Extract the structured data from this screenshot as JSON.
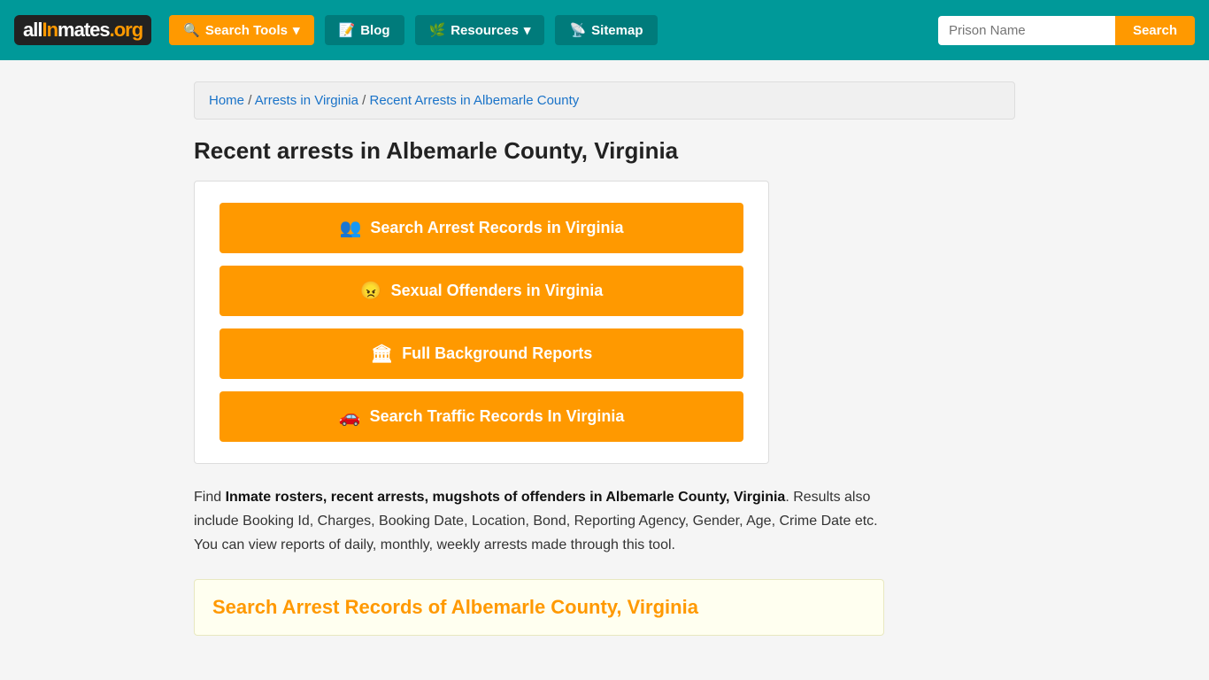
{
  "navbar": {
    "logo": {
      "all": "all",
      "in": "In",
      "mates": "mates",
      "org": ".org"
    },
    "nav_items": [
      {
        "id": "search-tools",
        "label": "Search Tools",
        "icon": "🔍",
        "has_dropdown": true
      },
      {
        "id": "blog",
        "label": "Blog",
        "icon": "📝",
        "has_dropdown": false
      },
      {
        "id": "resources",
        "label": "Resources",
        "icon": "🌿",
        "has_dropdown": true
      },
      {
        "id": "sitemap",
        "label": "Sitemap",
        "icon": "📡",
        "has_dropdown": false
      }
    ],
    "search_placeholder": "Prison Name",
    "search_button_label": "Search"
  },
  "breadcrumb": {
    "items": [
      {
        "label": "Home",
        "href": "#"
      },
      {
        "label": "Arrests in Virginia",
        "href": "#"
      },
      {
        "label": "Recent Arrests in Albemarle County",
        "href": "#"
      }
    ]
  },
  "page_title": "Recent arrests in Albemarle County, Virginia",
  "action_buttons": [
    {
      "id": "search-arrests",
      "icon": "👥",
      "label": "Search Arrest Records in Virginia"
    },
    {
      "id": "sexual-offenders",
      "icon": "😠",
      "label": "Sexual Offenders in Virginia"
    },
    {
      "id": "background-reports",
      "icon": "🏛",
      "label": "Full Background Reports"
    },
    {
      "id": "traffic-records",
      "icon": "🚗",
      "label": "Search Traffic Records In Virginia"
    }
  ],
  "description": {
    "prefix": "Find ",
    "bold": "Inmate rosters, recent arrests, mugshots of offenders in Albemarle County, Virginia",
    "suffix": ". Results also include Booking Id, Charges, Booking Date, Location, Bond, Reporting Agency, Gender, Age, Crime Date etc. You can view reports of daily, monthly, weekly arrests made through this tool."
  },
  "section_box": {
    "title": "Search Arrest Records of Albemarle County, Virginia"
  }
}
